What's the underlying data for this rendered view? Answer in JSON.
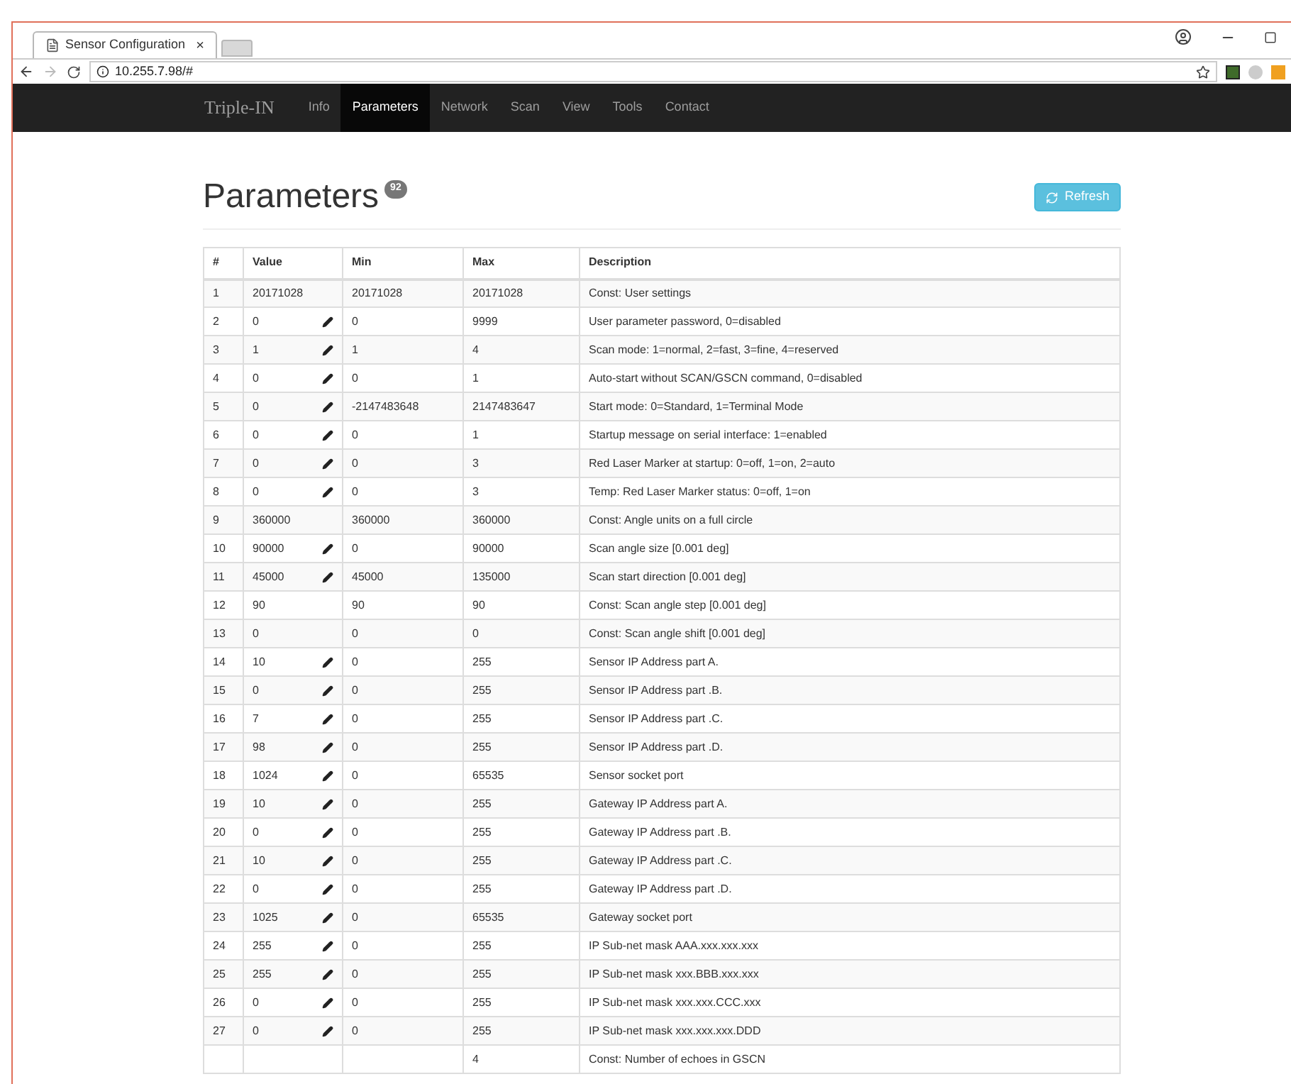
{
  "browser": {
    "tab_title": "Sensor Configuration",
    "tab_close": "×",
    "url": "10.255.7.98/#"
  },
  "navbar": {
    "brand": "Triple-IN",
    "items": [
      {
        "label": "Info",
        "selected": false
      },
      {
        "label": "Parameters",
        "selected": true
      },
      {
        "label": "Network",
        "selected": false
      },
      {
        "label": "Scan",
        "selected": false
      },
      {
        "label": "View",
        "selected": false
      },
      {
        "label": "Tools",
        "selected": false
      },
      {
        "label": "Contact",
        "selected": false
      }
    ]
  },
  "heading": {
    "title": "Parameters",
    "badge": "92"
  },
  "refresh_button": "Refresh",
  "table": {
    "columns": [
      "#",
      "Value",
      "Min",
      "Max",
      "Description"
    ],
    "rows": [
      {
        "n": "1",
        "value": "20171028",
        "editable": false,
        "min": "20171028",
        "max": "20171028",
        "description": "Const: User settings"
      },
      {
        "n": "2",
        "value": "0",
        "editable": true,
        "min": "0",
        "max": "9999",
        "description": "User parameter password, 0=disabled"
      },
      {
        "n": "3",
        "value": "1",
        "editable": true,
        "min": "1",
        "max": "4",
        "description": "Scan mode: 1=normal, 2=fast, 3=fine, 4=reserved"
      },
      {
        "n": "4",
        "value": "0",
        "editable": true,
        "min": "0",
        "max": "1",
        "description": "Auto-start without SCAN/GSCN command, 0=disabled"
      },
      {
        "n": "5",
        "value": "0",
        "editable": true,
        "min": "-2147483648",
        "max": "2147483647",
        "description": "Start mode: 0=Standard, 1=Terminal Mode"
      },
      {
        "n": "6",
        "value": "0",
        "editable": true,
        "min": "0",
        "max": "1",
        "description": "Startup message on serial interface: 1=enabled"
      },
      {
        "n": "7",
        "value": "0",
        "editable": true,
        "min": "0",
        "max": "3",
        "description": "Red Laser Marker at startup: 0=off, 1=on, 2=auto"
      },
      {
        "n": "8",
        "value": "0",
        "editable": true,
        "min": "0",
        "max": "3",
        "description": "Temp: Red Laser Marker status: 0=off, 1=on"
      },
      {
        "n": "9",
        "value": "360000",
        "editable": false,
        "min": "360000",
        "max": "360000",
        "description": "Const: Angle units on a full circle"
      },
      {
        "n": "10",
        "value": "90000",
        "editable": true,
        "min": "0",
        "max": "90000",
        "description": "Scan angle size [0.001 deg]"
      },
      {
        "n": "11",
        "value": "45000",
        "editable": true,
        "min": "45000",
        "max": "135000",
        "description": "Scan start direction [0.001 deg]"
      },
      {
        "n": "12",
        "value": "90",
        "editable": false,
        "min": "90",
        "max": "90",
        "description": "Const: Scan angle step [0.001 deg]"
      },
      {
        "n": "13",
        "value": "0",
        "editable": false,
        "min": "0",
        "max": "0",
        "description": "Const: Scan angle shift [0.001 deg]"
      },
      {
        "n": "14",
        "value": "10",
        "editable": true,
        "min": "0",
        "max": "255",
        "description": "Sensor IP Address part A."
      },
      {
        "n": "15",
        "value": "0",
        "editable": true,
        "min": "0",
        "max": "255",
        "description": "Sensor IP Address part .B."
      },
      {
        "n": "16",
        "value": "7",
        "editable": true,
        "min": "0",
        "max": "255",
        "description": "Sensor IP Address part .C."
      },
      {
        "n": "17",
        "value": "98",
        "editable": true,
        "min": "0",
        "max": "255",
        "description": "Sensor IP Address part .D."
      },
      {
        "n": "18",
        "value": "1024",
        "editable": true,
        "min": "0",
        "max": "65535",
        "description": "Sensor socket port"
      },
      {
        "n": "19",
        "value": "10",
        "editable": true,
        "min": "0",
        "max": "255",
        "description": "Gateway IP Address part A."
      },
      {
        "n": "20",
        "value": "0",
        "editable": true,
        "min": "0",
        "max": "255",
        "description": "Gateway IP Address part .B."
      },
      {
        "n": "21",
        "value": "10",
        "editable": true,
        "min": "0",
        "max": "255",
        "description": "Gateway IP Address part .C."
      },
      {
        "n": "22",
        "value": "0",
        "editable": true,
        "min": "0",
        "max": "255",
        "description": "Gateway IP Address part .D."
      },
      {
        "n": "23",
        "value": "1025",
        "editable": true,
        "min": "0",
        "max": "65535",
        "description": "Gateway socket port"
      },
      {
        "n": "24",
        "value": "255",
        "editable": true,
        "min": "0",
        "max": "255",
        "description": "IP Sub-net mask AAA.xxx.xxx.xxx"
      },
      {
        "n": "25",
        "value": "255",
        "editable": true,
        "min": "0",
        "max": "255",
        "description": "IP Sub-net mask xxx.BBB.xxx.xxx"
      },
      {
        "n": "26",
        "value": "0",
        "editable": true,
        "min": "0",
        "max": "255",
        "description": "IP Sub-net mask xxx.xxx.CCC.xxx"
      },
      {
        "n": "27",
        "value": "0",
        "editable": true,
        "min": "0",
        "max": "255",
        "description": "IP Sub-net mask xxx.xxx.xxx.DDD"
      },
      {
        "max": "4",
        "description": "Const: Number of echoes in GSCN"
      }
    ]
  }
}
